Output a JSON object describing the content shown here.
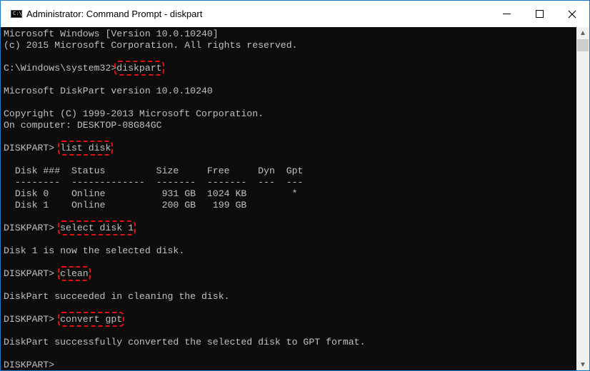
{
  "window": {
    "title": "Administrator: Command Prompt - diskpart",
    "icon_label": "C:\\",
    "controls": {
      "minimize": "minimize",
      "maximize": "maximize",
      "close": "close"
    }
  },
  "console": {
    "prompt_dir": "C:\\Windows\\system32>",
    "prompt_diskpart": "DISKPART> ",
    "lines": {
      "l0": "Microsoft Windows [Version 10.0.10240]",
      "l1": "(c) 2015 Microsoft Corporation. All rights reserved.",
      "l3_cmd": "diskpart",
      "l5": "Microsoft DiskPart version 10.0.10240",
      "l7": "Copyright (C) 1999-2013 Microsoft Corporation.",
      "l8": "On computer: DESKTOP-08G84GC",
      "l10_cmd": "list disk",
      "l12": "  Disk ###  Status         Size     Free     Dyn  Gpt",
      "l13": "  --------  -------------  -------  -------  ---  ---",
      "l14": "  Disk 0    Online          931 GB  1024 KB        *",
      "l15": "  Disk 1    Online          200 GB   199 GB",
      "l17_cmd": "select disk 1",
      "l19": "Disk 1 is now the selected disk.",
      "l21_cmd": "clean",
      "l23": "DiskPart succeeded in cleaning the disk.",
      "l25_cmd": "convert gpt",
      "l27": "DiskPart successfully converted the selected disk to GPT format.",
      "l29": "DISKPART>"
    },
    "highlight_color": "#dd1111",
    "text_color": "#c0c0c0",
    "background": "#0c0c0c"
  },
  "disk_table": {
    "columns": [
      "Disk ###",
      "Status",
      "Size",
      "Free",
      "Dyn",
      "Gpt"
    ],
    "rows": [
      [
        "Disk 0",
        "Online",
        "931 GB",
        "1024 KB",
        "",
        "*"
      ],
      [
        "Disk 1",
        "Online",
        "200 GB",
        "199 GB",
        "",
        ""
      ]
    ]
  }
}
